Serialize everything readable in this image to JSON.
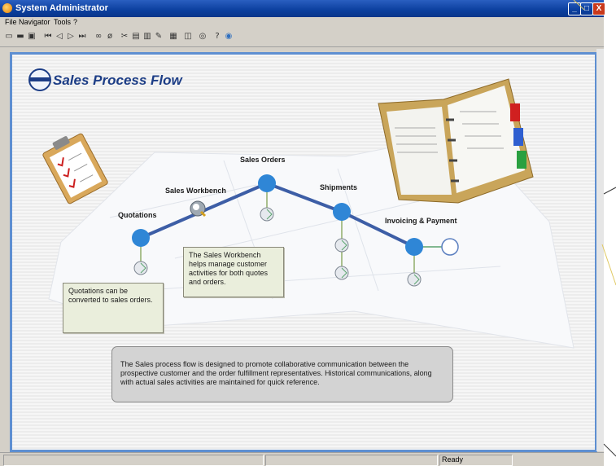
{
  "window": {
    "title": "System Administrator",
    "buttons": {
      "minimize": "_",
      "maximize": "□",
      "close": "X"
    }
  },
  "menu": [
    "File",
    "Navigator",
    "Tools",
    "?"
  ],
  "toolbar_icons": [
    "new-icon",
    "print-icon",
    "copy-icon",
    "first-record-icon",
    "prev-record-icon",
    "next-record-icon",
    "last-record-icon",
    "link-icon",
    "unlink-icon",
    "tools-icon",
    "save-icon",
    "paste-icon",
    "edit-icon",
    "grid-icon",
    "query-icon",
    "target-icon",
    "help-icon",
    "world-icon"
  ],
  "page": {
    "title": "Sales Process Flow",
    "stages": [
      {
        "label": "Quotations"
      },
      {
        "label": "Sales Workbench"
      },
      {
        "label": "Sales Orders"
      },
      {
        "label": "Shipments"
      },
      {
        "label": "Invoicing & Payment"
      }
    ],
    "notes": {
      "quotations": "Quotations can be converted to sales orders.",
      "workbench": "The Sales Workbench helps manage customer activities for both quotes and orders."
    },
    "summary": "The Sales process flow is designed to promote collaborative communication between the prospective customer and the order fulfillment representatives.  Historical communications, along with actual sales activities are maintained for quick reference."
  },
  "status": {
    "text": "Ready"
  },
  "colors": {
    "accent": "#2f86d6",
    "frame": "#5e8fd1",
    "title": "#1c3d86",
    "titlebar": "#0b3f9e"
  }
}
